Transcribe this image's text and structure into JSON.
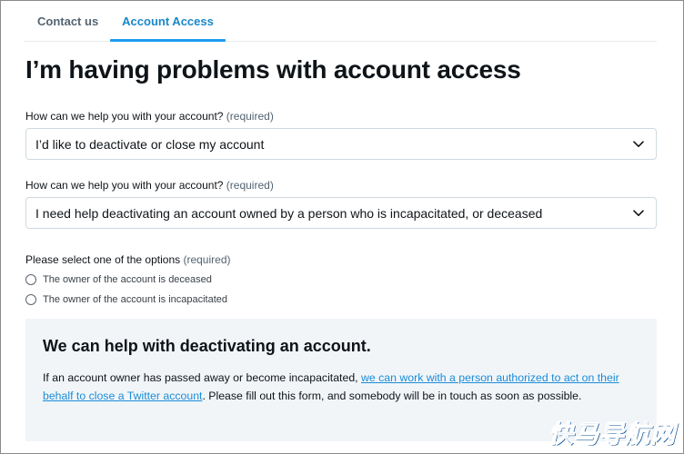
{
  "tabs": [
    {
      "label": "Contact us",
      "active": false
    },
    {
      "label": "Account Access",
      "active": true
    }
  ],
  "page_title": "I’m having problems with account access",
  "field1": {
    "label": "How can we help you with your account?",
    "required": "(required)",
    "value": "I’d like to deactivate or close my account"
  },
  "field2": {
    "label": "How can we help you with your account?",
    "required": "(required)",
    "value": "I need help deactivating an account owned by a person who is incapacitated, or deceased"
  },
  "options": {
    "label": "Please select one of the options",
    "required": "(required)",
    "items": [
      {
        "label": "The owner of the account is deceased",
        "selected": false
      },
      {
        "label": "The owner of the account is incapacitated",
        "selected": false
      }
    ]
  },
  "info": {
    "title": "We can help with deactivating an account.",
    "text_before": "If an account owner has passed away or become incapacitated, ",
    "link": "we can work with a person authorized to act on their behalf to close a Twitter account",
    "text_after": ". Please fill out this form, and somebody will be in touch as soon as possible."
  },
  "watermark": "快马导航网",
  "icons": {
    "dropdown": "chevron-down-icon",
    "radio": "radio-unchecked-icon"
  },
  "colors": {
    "accent": "#1d9bf0",
    "text": "#0f1419",
    "muted": "#536471",
    "info_bg": "#f1f5f8"
  }
}
